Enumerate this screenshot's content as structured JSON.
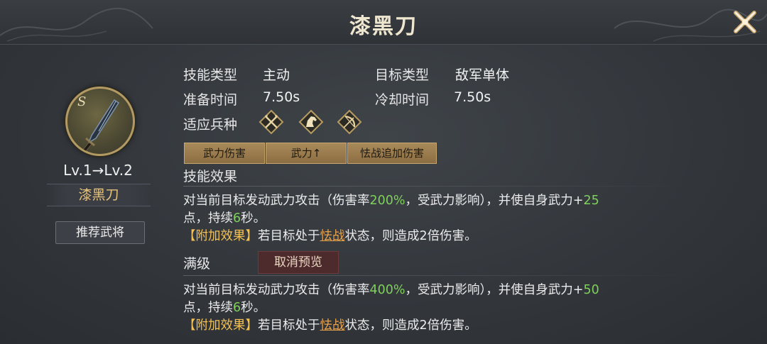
{
  "header": {
    "title": "漆黑刀"
  },
  "skill": {
    "grade": "S",
    "level_text": "Lv.1→Lv.2",
    "name": "漆黑刀",
    "recommend_label": "推荐武将"
  },
  "info": {
    "skill_type_label": "技能类型",
    "skill_type_value": "主动",
    "target_type_label": "目标类型",
    "target_type_value": "敌军单体",
    "prep_time_label": "准备时间",
    "prep_time_value": "7.50s",
    "cooldown_label": "冷却时间",
    "cooldown_value": "7.50s",
    "troops_label": "适应兵种",
    "troop_icons": [
      "crossed-halberds-icon",
      "horse-icon",
      "bow-icon"
    ]
  },
  "tags": [
    "武力伤害",
    "武力↑",
    "怯战追加伤害"
  ],
  "effect": {
    "section_label": "技能效果",
    "line1_a": "对当前目标发动武力攻击（伤害率",
    "line1_rate": "200%",
    "line1_b": "，受武力影响），并使自身武力+",
    "line1_bonus": "25",
    "line2_a": "点，持续",
    "line2_dur": "6",
    "line2_b": "秒。",
    "extra_tag": "【附加效果】",
    "extra_a": "若目标处于",
    "extra_status": "怯战",
    "extra_b": "状态，则造成2倍伤害。"
  },
  "maxlevel": {
    "section_label": "满级",
    "cancel_label": "取消预览",
    "line1_a": "对当前目标发动武力攻击（伤害率",
    "line1_rate": "400%",
    "line1_b": "，受武力影响），并使自身武力+",
    "line1_bonus": "50",
    "line2_a": "点，持续",
    "line2_dur": "6",
    "line2_b": "秒。",
    "extra_tag": "【附加效果】",
    "extra_a": "若目标处于",
    "extra_status": "怯战",
    "extra_b": "状态，则造成2倍伤害。"
  },
  "colors": {
    "accent_gold": "#e7c37b",
    "value_green": "#7fd05c",
    "link_orange": "#e8a24a"
  }
}
